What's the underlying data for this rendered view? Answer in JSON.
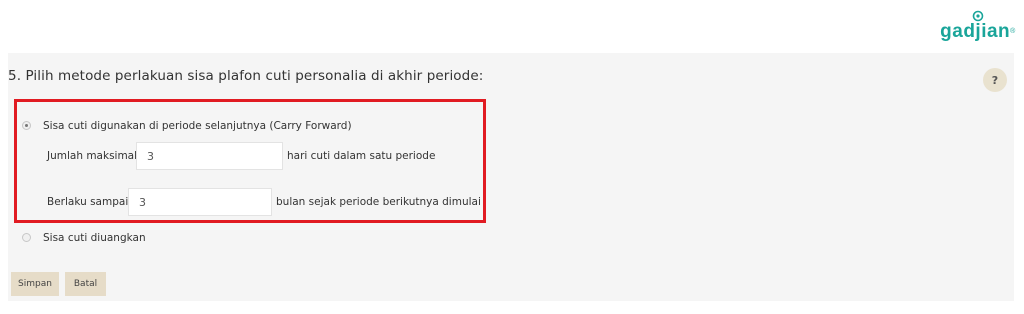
{
  "brand": {
    "logo_text": "gadjian",
    "logo_sup": "®"
  },
  "question": {
    "text": "5. Pilih metode perlakuan sisa plafon cuti personalia di akhir periode:"
  },
  "help": {
    "label": "?"
  },
  "options": {
    "carry_forward": {
      "label": "Sisa cuti digunakan di periode selanjutnya (Carry Forward)",
      "selected": true,
      "max_days": {
        "prefix": "Jumlah maksimal",
        "value": "3",
        "suffix": "hari cuti dalam satu periode"
      },
      "valid_until": {
        "prefix": "Berlaku sampai",
        "value": "3",
        "suffix": "bulan sejak periode berikutnya dimulai"
      }
    },
    "cash_out": {
      "label": "Sisa cuti diuangkan",
      "selected": false
    }
  },
  "actions": {
    "save_label": "Simpan",
    "cancel_label": "Batal"
  },
  "colors": {
    "brand": "#1aa59a",
    "highlight": "#e11b22",
    "button_bg": "#e6dcc8",
    "panel_bg": "#f5f5f5"
  }
}
